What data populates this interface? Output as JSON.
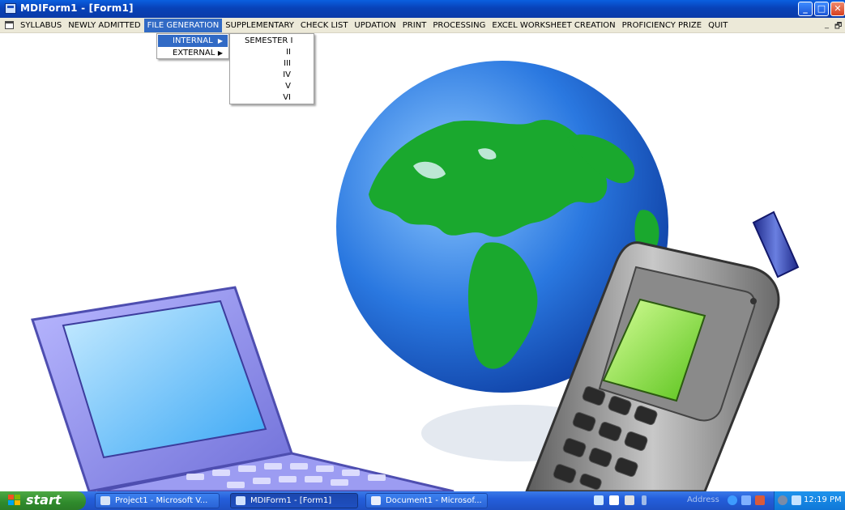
{
  "window": {
    "title": "MDIForm1 - [Form1]",
    "min_glyph": "_",
    "max_glyph": "□",
    "close_glyph": "✕"
  },
  "menubar": {
    "items": [
      "SYLLABUS",
      "NEWLY ADMITTED",
      "FILE GENERATION",
      "SUPPLEMENTARY",
      "CHECK LIST",
      "UPDATION",
      "PRINT",
      "PROCESSING",
      "EXCEL WORKSHEET CREATION",
      "PROFICIENCY PRIZE",
      "QUIT"
    ],
    "active": "FILE GENERATION",
    "mdi_min": "_",
    "mdi_restore": "🗗"
  },
  "file_generation_menu": {
    "items": [
      "INTERNAL",
      "EXTERNAL"
    ],
    "highlighted": "INTERNAL",
    "arrow_glyph": "▶"
  },
  "internal_submenu": {
    "items": [
      "SEMESTER I",
      "II",
      "III",
      "IV",
      "V",
      "VI"
    ]
  },
  "taskbar": {
    "start_label": "start",
    "tasks": [
      {
        "label": "Project1 - Microsoft V...",
        "icon": "vb-project-icon"
      },
      {
        "label": "MDIForm1 - [Form1]",
        "icon": "form-icon"
      },
      {
        "label": "Document1 - Microsof...",
        "icon": "word-document-icon"
      }
    ],
    "active_task": "MDIForm1 - [Form1]",
    "address_label": "Address",
    "clock": "12:19 PM"
  },
  "colors": {
    "titlebar": "#0842b8",
    "menu_highlight": "#316ac5",
    "taskbar": "#245edb",
    "start_button": "#2f8a2c"
  }
}
